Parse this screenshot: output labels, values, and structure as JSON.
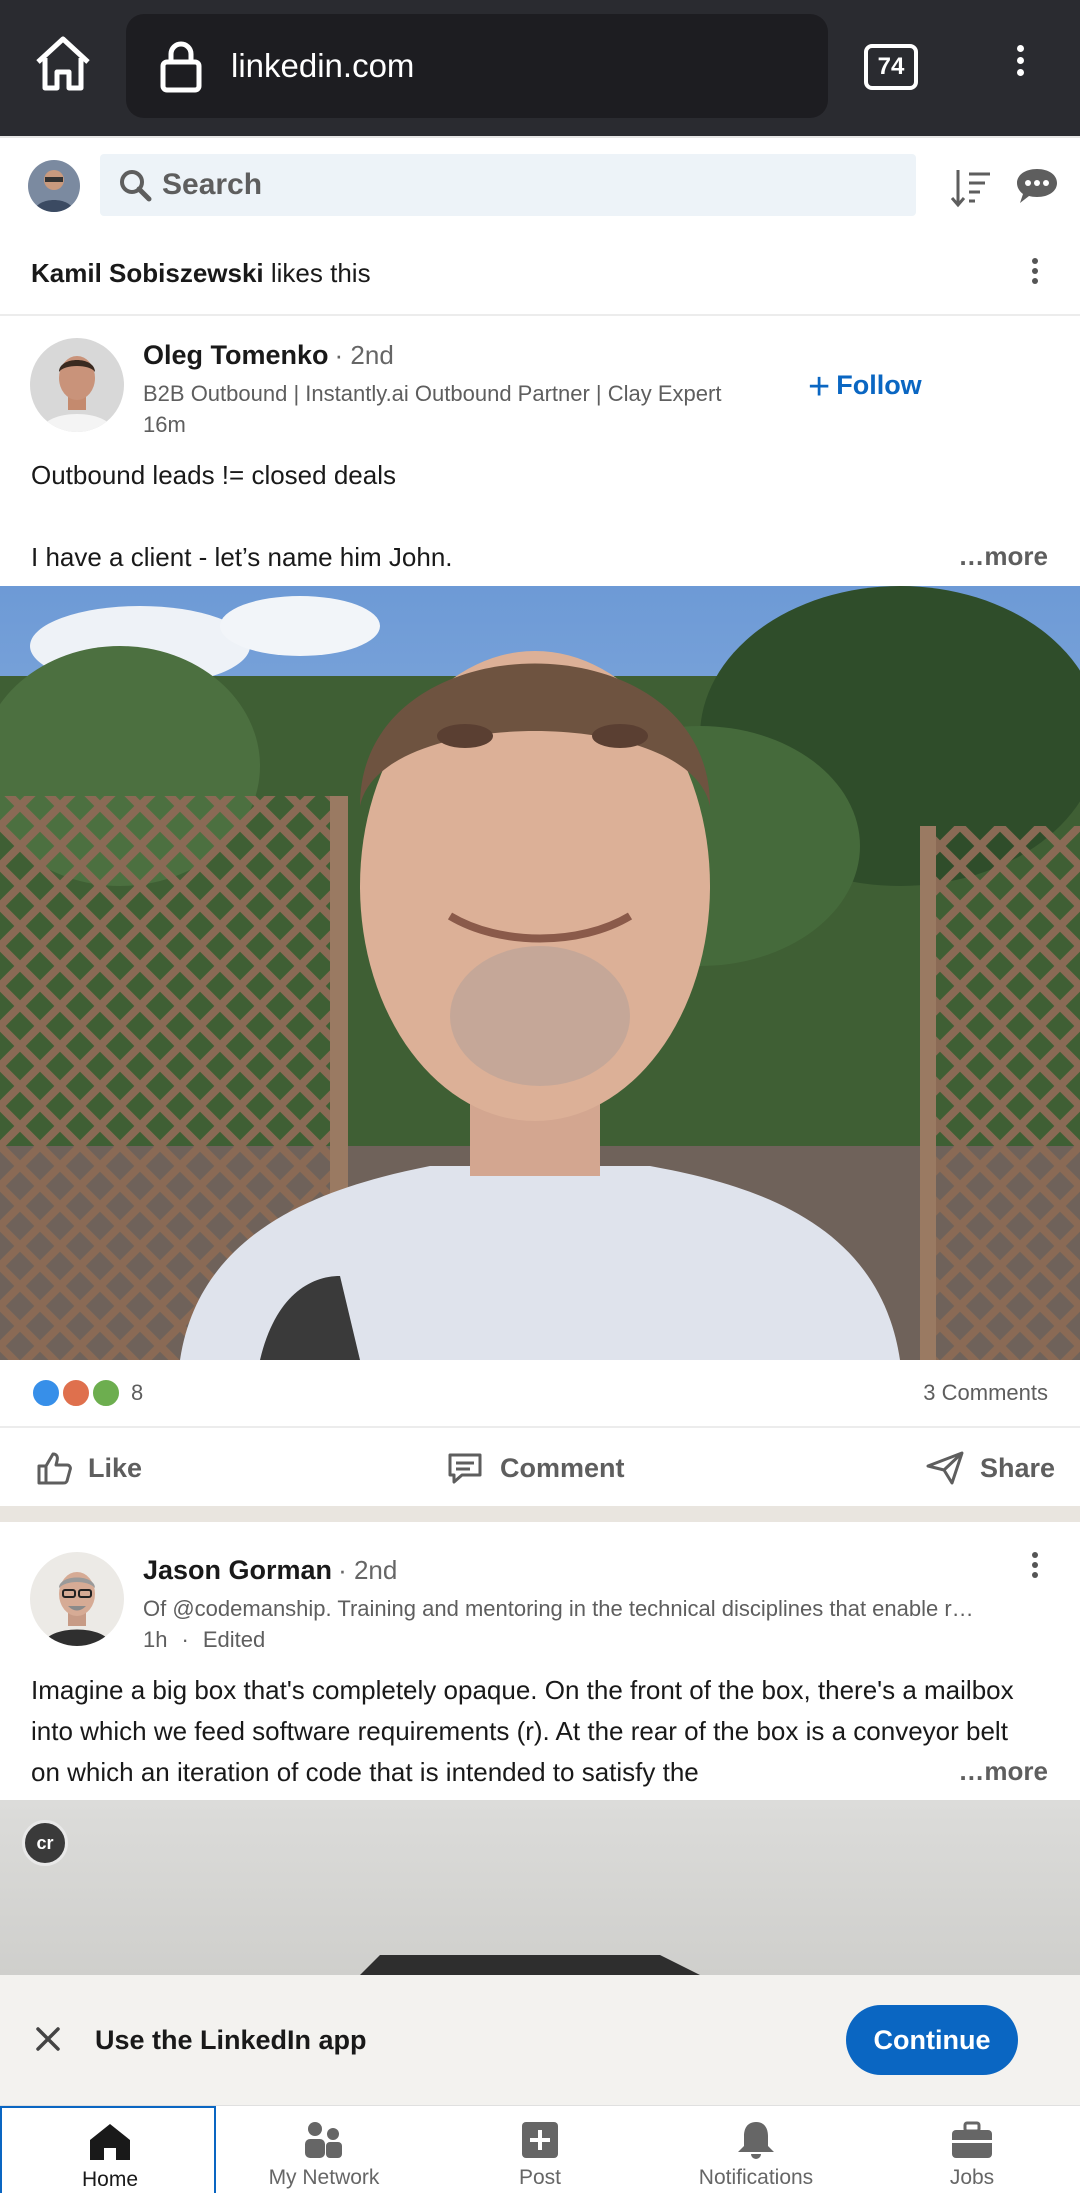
{
  "browser": {
    "url": "linkedin.com",
    "tab_count": "74"
  },
  "header": {
    "search_placeholder": "Search"
  },
  "social_context": {
    "actor": "Kamil Sobiszewski",
    "action": " likes this"
  },
  "post1": {
    "author": "Oleg Tomenko",
    "degree": "· 2nd",
    "headline": "B2B Outbound | Instantly.ai Outbound Partner | Clay Expert",
    "time": "16m",
    "follow_label": "Follow",
    "text_line1": "Outbound leads != closed deals",
    "text_line2": "I have a client - let’s name him John.",
    "more_label": "…more",
    "reaction_count": "8",
    "comments": "3 Comments",
    "actions": {
      "like": "Like",
      "comment": "Comment",
      "share": "Share"
    }
  },
  "post2": {
    "author": "Jason Gorman",
    "degree": "· 2nd",
    "headline": "Of @codemanship. Training and mentoring in the technical disciplines that enable r…",
    "time": "1h",
    "edited": "Edited",
    "text": "Imagine a big box that's completely opaque. On the front of the box, there's a mailbox into which we feed software requirements (r). At the rear of the box is a conveyor belt on which an iteration of code that is intended to satisfy the",
    "more_label": "…more",
    "image_badge": "cr"
  },
  "app_banner": {
    "text": "Use the LinkedIn app",
    "button": "Continue"
  },
  "bottom_nav": {
    "home": "Home",
    "network": "My Network",
    "post": "Post",
    "notifications": "Notifications",
    "jobs": "Jobs"
  },
  "colors": {
    "brand_blue": "#0a66c2",
    "browser_bar": "#2a2b30"
  }
}
